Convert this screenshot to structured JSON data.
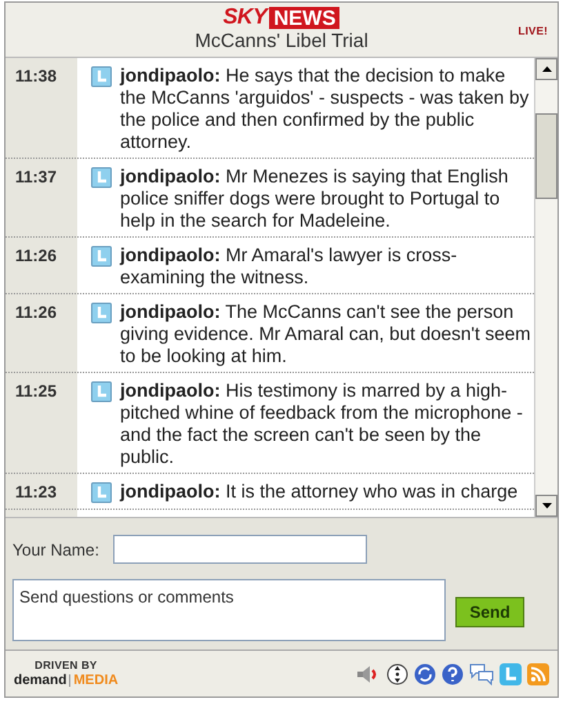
{
  "header": {
    "logo_sky": "SKY",
    "logo_news": "NEWS",
    "title": "McCanns' Libel Trial",
    "live_badge": "LIVE!"
  },
  "messages": [
    {
      "time": "11:38",
      "author": "jondipaolo:",
      "text": "He says that the decision to make the McCanns 'arguidos' - suspects - was taken by the police and then confirmed by the public attorney."
    },
    {
      "time": "11:37",
      "author": "jondipaolo:",
      "text": "Mr Menezes is saying that English police sniffer dogs were brought to Portugal to help in the search for Madeleine."
    },
    {
      "time": "11:26",
      "author": "jondipaolo:",
      "text": "Mr Amaral's lawyer is cross-examining the witness."
    },
    {
      "time": "11:26",
      "author": "jondipaolo:",
      "text": "The McCanns can't see the person giving evidence. Mr Amaral can, but doesn't seem to be looking at him."
    },
    {
      "time": "11:25",
      "author": "jondipaolo:",
      "text": "His testimony is marred by a high-pitched whine of feedback from the microphone - and the fact the screen can't be seen by the public."
    },
    {
      "time": "11:23",
      "author": "jondipaolo:",
      "text": "It is the attorney who was in charge"
    }
  ],
  "form": {
    "name_label": "Your Name:",
    "comment_placeholder": "Send questions or comments",
    "send_button": "Send"
  },
  "footer": {
    "driven_by": "DRIVEN BY",
    "brand_demand": "demand",
    "brand_media": "MEDIA"
  }
}
